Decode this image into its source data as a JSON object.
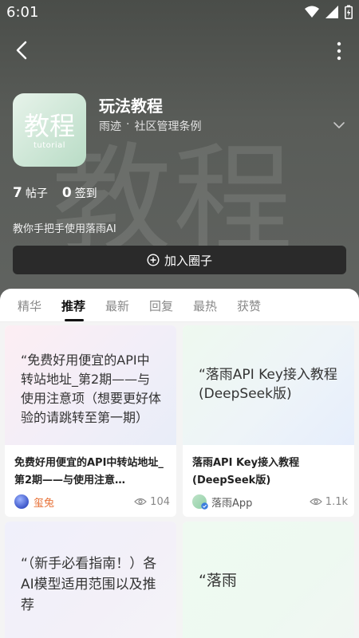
{
  "status_bar": {
    "time": "6:01"
  },
  "circle": {
    "logo_text": "教程",
    "logo_subtext": "tutorial",
    "watermark": "教程",
    "title": "玩法教程",
    "org": "雨迹",
    "separator": "·",
    "rules_link": "社区管理条例",
    "posts_count": "7",
    "posts_label": "帖子",
    "checkins_count": "0",
    "checkins_label": "签到",
    "description": "教你手把手使用落雨AI",
    "join_label": "加入圈子"
  },
  "tabs": [
    {
      "label": "精华"
    },
    {
      "label": "推荐",
      "active": true
    },
    {
      "label": "最新"
    },
    {
      "label": "回复"
    },
    {
      "label": "最热"
    },
    {
      "label": "获赞"
    }
  ],
  "posts": [
    {
      "cover_text": "“免费好用便宜的API中转站地址_第2期——与使用注意项（想要更好体验的请跳转至第一期）",
      "title": "免费好用便宜的API中转站地址_第2期——与使用注意…",
      "author": "玺兔",
      "author_color": "#e8743b",
      "views": "104"
    },
    {
      "cover_text": "“落雨API Key接入教程(DeepSeek版)",
      "title": "落雨API Key接入教程(DeepSeek版)",
      "author": "落雨App",
      "author_color": "#555555",
      "views": "1.1k"
    },
    {
      "cover_text": "“（新手必看指南！）各AI模型适用范围以及推荐"
    },
    {
      "cover_text": "“落雨"
    }
  ],
  "colors": {
    "accent_dark": "#2a2a2a",
    "author_highlight": "#e8743b",
    "verified_badge": "#3b7ddd"
  }
}
